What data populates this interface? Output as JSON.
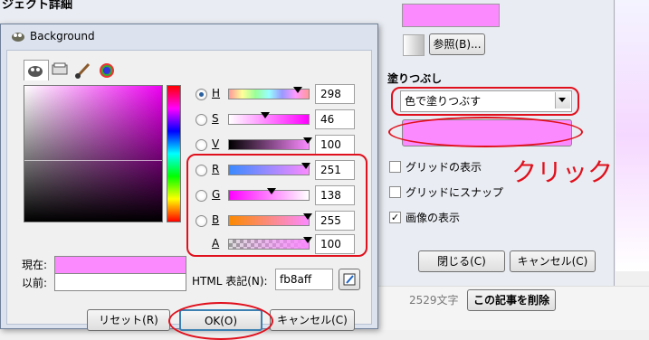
{
  "bg": {
    "title_fragment": "ジェクト詳細",
    "browse_button": "参照(B)...",
    "fill_label": "塗りつぶし",
    "fill_select": "色で塗りつぶす",
    "click_annotation": "クリック",
    "show_grid": "グリッドの表示",
    "snap_grid": "グリッドにスナップ",
    "show_image": "画像の表示",
    "close_button": "閉じる(C)",
    "cancel_button": "キャンセル(C)",
    "word_count": "2529文字",
    "delete_article": "この記事を削除"
  },
  "dialog": {
    "title": "Background",
    "channels": [
      {
        "key": "H",
        "value": "298"
      },
      {
        "key": "S",
        "value": "46"
      },
      {
        "key": "V",
        "value": "100"
      },
      {
        "key": "R",
        "value": "251"
      },
      {
        "key": "G",
        "value": "138"
      },
      {
        "key": "B",
        "value": "255"
      },
      {
        "key": "A",
        "value": "100"
      }
    ],
    "current_label": "現在:",
    "previous_label": "以前:",
    "html_label": "HTML 表記(N):",
    "html_value": "fb8aff",
    "reset_button": "リセット(R)",
    "ok_button": "OK(O)",
    "cancel_button": "キャンセル(C)"
  },
  "colors": {
    "selected": "#fb8aff",
    "annotation_red": "#e0101c"
  }
}
